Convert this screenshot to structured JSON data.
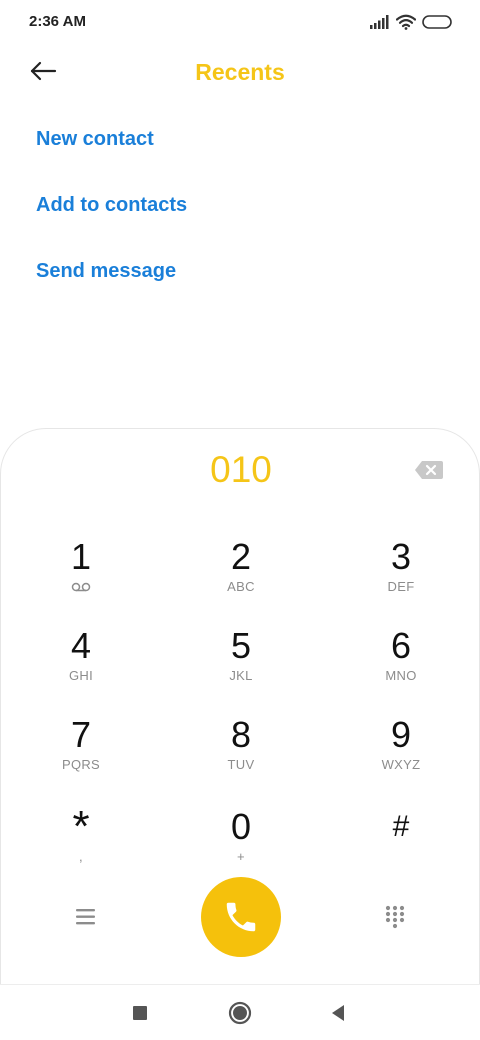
{
  "status_bar": {
    "time": "2:36 AM"
  },
  "header": {
    "title": "Recents"
  },
  "actions": {
    "new_contact": "New contact",
    "add_to_contacts": "Add to contacts",
    "send_message": "Send message"
  },
  "dialer": {
    "number": "010",
    "keys": [
      {
        "digit": "1",
        "letters": ""
      },
      {
        "digit": "2",
        "letters": "ABC"
      },
      {
        "digit": "3",
        "letters": "DEF"
      },
      {
        "digit": "4",
        "letters": "GHI"
      },
      {
        "digit": "5",
        "letters": "JKL"
      },
      {
        "digit": "6",
        "letters": "MNO"
      },
      {
        "digit": "7",
        "letters": "PQRS"
      },
      {
        "digit": "8",
        "letters": "TUV"
      },
      {
        "digit": "9",
        "letters": "WXYZ"
      },
      {
        "digit": "*",
        "letters": ","
      },
      {
        "digit": "0",
        "letters": "+"
      },
      {
        "digit": "#",
        "letters": ""
      }
    ]
  },
  "icons": {
    "back": "arrow-left-icon",
    "backspace": "backspace-icon",
    "voicemail": "voicemail-icon",
    "menu": "menu-icon",
    "call": "phone-icon",
    "dialpad": "dialpad-icon",
    "nav_recents": "square-icon",
    "nav_home": "circle-icon",
    "nav_back": "triangle-back-icon"
  },
  "colors": {
    "accent_yellow": "#f5c518",
    "call_button": "#f5c10c",
    "link_blue": "#1a7fd9"
  }
}
